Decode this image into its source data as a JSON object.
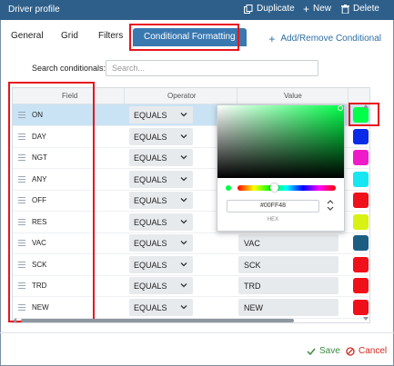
{
  "window": {
    "title": "Driver profile"
  },
  "actions": {
    "duplicate": "Duplicate",
    "new": "New",
    "delete": "Delete"
  },
  "tabs": [
    {
      "label": "General",
      "active": false
    },
    {
      "label": "Grid",
      "active": false
    },
    {
      "label": "Filters",
      "active": false
    },
    {
      "label": "Conditional Formatting",
      "active": true
    }
  ],
  "add_remove_label": "Add/Remove Conditional",
  "search": {
    "label": "Search conditionals:",
    "placeholder": "Search...",
    "value": ""
  },
  "columns": {
    "field": "Field",
    "operator": "Operator",
    "value": "Value"
  },
  "rows": [
    {
      "field": "ON",
      "operator": "EQUALS",
      "value": "",
      "color": "#00FF48"
    },
    {
      "field": "DAY",
      "operator": "EQUALS",
      "value": "",
      "color": "#0A2BE8"
    },
    {
      "field": "NGT",
      "operator": "EQUALS",
      "value": "",
      "color": "#F01BC8"
    },
    {
      "field": "ANY",
      "operator": "EQUALS",
      "value": "",
      "color": "#18E6F2"
    },
    {
      "field": "OFF",
      "operator": "EQUALS",
      "value": "",
      "color": "#F0101A"
    },
    {
      "field": "RES",
      "operator": "EQUALS",
      "value": "",
      "color": "#D8F214"
    },
    {
      "field": "VAC",
      "operator": "EQUALS",
      "value": "VAC",
      "color": "#1B5E82"
    },
    {
      "field": "SCK",
      "operator": "EQUALS",
      "value": "SCK",
      "color": "#F0101A"
    },
    {
      "field": "TRD",
      "operator": "EQUALS",
      "value": "TRD",
      "color": "#F0101A"
    },
    {
      "field": "NEW",
      "operator": "EQUALS",
      "value": "NEW",
      "color": "#F0101A"
    }
  ],
  "picker": {
    "hex": "#00FF48",
    "mode_label": "HEX",
    "hue_color": "#00FF48"
  },
  "footer": {
    "save": "Save",
    "cancel": "Cancel"
  },
  "colors": {
    "titlebar": "#2E5F8A",
    "active_tab": "#3A78B0",
    "selected_row": "#C9E3F5",
    "highlight": "#E8141F",
    "save": "#3B8A3E",
    "cancel": "#D0281E"
  }
}
